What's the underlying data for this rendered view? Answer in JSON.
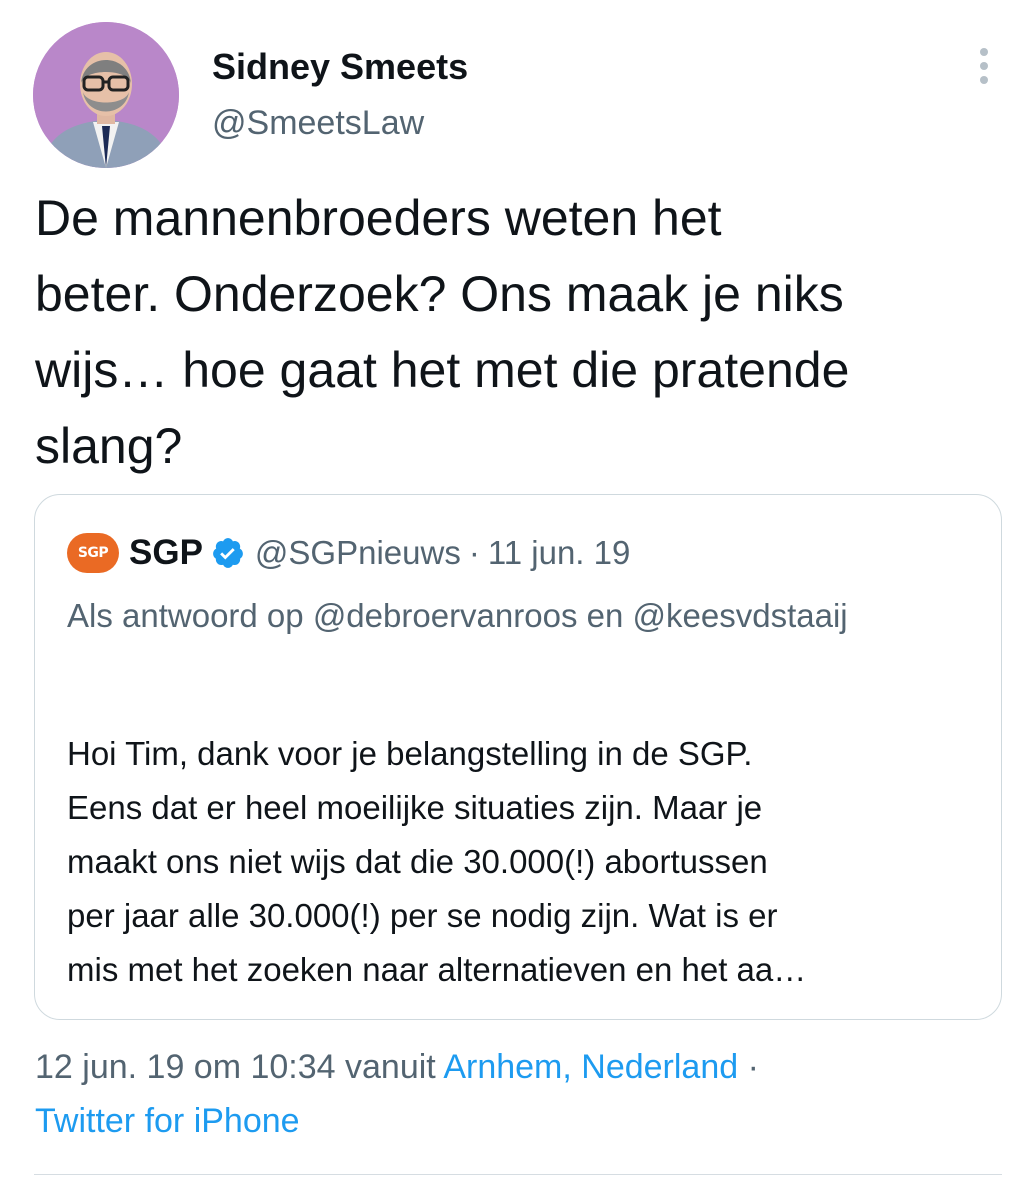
{
  "author": {
    "display_name": "Sidney Smeets",
    "handle": "@SmeetsLaw"
  },
  "tweet": {
    "text": "De mannenbroeders weten het\nbeter. Onderzoek? Ons maak je niks\nwijs… hoe gaat het met die pratende\nslang?"
  },
  "quoted_tweet": {
    "logo_text": "SGP",
    "display_name": "SGP",
    "handle": "@SGPnieuws",
    "separator": "·",
    "date": "11 jun. 19",
    "reply_prefix": "Als antwoord op",
    "reply_to_1": "@debroervanroos",
    "reply_joiner": "en",
    "reply_to_2": "@keesvdstaaij",
    "text": "Hoi Tim, dank voor je belangstelling in de SGP.\nEens dat er heel moeilijke situaties zijn. Maar je\nmaakt ons niet wijs dat die 30.000(!) abortussen\nper jaar alle 30.000(!) per se nodig zijn. Wat is er\nmis met het zoeken naar alternatieven en het aa…"
  },
  "meta": {
    "timestamp": "12 jun. 19 om 10:34",
    "via_prefix": "vanuit",
    "location": "Arnhem, Nederland",
    "separator": "·",
    "source": "Twitter for iPhone"
  },
  "colors": {
    "text_primary": "#0f1419",
    "text_secondary": "#536471",
    "link": "#1d9bf0",
    "border": "#cfd9de",
    "sgp_orange": "#ea6a24",
    "avatar_bg": "#b987c9"
  },
  "icons": {
    "more": "vertical-ellipsis-icon",
    "verified": "verified-badge-icon"
  }
}
